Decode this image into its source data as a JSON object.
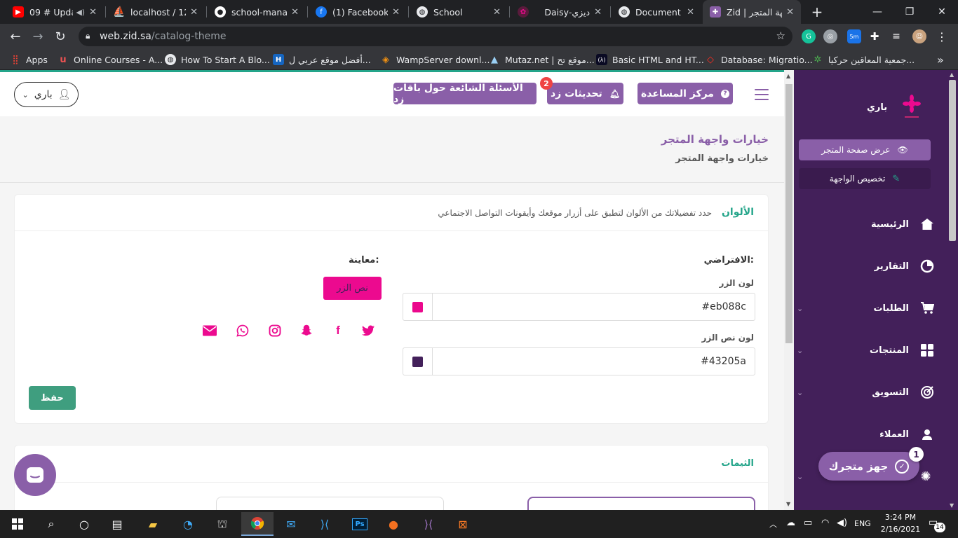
{
  "browser": {
    "tabs": [
      {
        "title": "09 # Upda",
        "icon": "youtube-icon",
        "color": "#ff0000"
      },
      {
        "title": "localhost / 127",
        "icon": "phpmyadmin-icon",
        "color": "#f29111"
      },
      {
        "title": "school-manag",
        "icon": "github-icon",
        "color": "#444444"
      },
      {
        "title": "(1) Facebook",
        "icon": "facebook-icon",
        "color": "#1877f2"
      },
      {
        "title": "School",
        "icon": "globe-icon",
        "color": "#5f6368"
      },
      {
        "title": "Daisy-ديزي",
        "icon": "daisy-icon",
        "color": "#ec0a8f"
      },
      {
        "title": "Document",
        "icon": "globe-icon",
        "color": "#5f6368"
      },
      {
        "title": "Zid | جهة المتجر",
        "icon": "zid-icon",
        "color": "#8a5fa8"
      }
    ],
    "new_tab": "+",
    "url_host": "web.zid.sa",
    "url_path": "/catalog-theme",
    "bookmarks": [
      {
        "label": "Apps",
        "icon": "apps-grid-icon"
      },
      {
        "label": "Online Courses - A...",
        "icon": "udemy-icon"
      },
      {
        "label": "How To Start A Blo...",
        "icon": "globe-icon"
      },
      {
        "label": "أفضل موقع عربي ل...",
        "icon": "h-icon"
      },
      {
        "label": "WampServer downl...",
        "icon": "wamp-icon"
      },
      {
        "label": "Mutaz.net | موقع تح...",
        "icon": "mutaz-icon"
      },
      {
        "label": "Basic HTML and HT...",
        "icon": "freecodecamp-icon"
      },
      {
        "label": "Database: Migratio...",
        "icon": "laravel-icon"
      },
      {
        "label": "جمعية المعاقين حركيا...",
        "icon": "association-icon"
      }
    ],
    "more_bookmarks": "»"
  },
  "topbar": {
    "help_center": "مركز المساعدة",
    "challenges": "تحديثات زد",
    "challenges_badge": "2",
    "faq": "الأسئلة الشائعة حول باقات زد",
    "user_name": "باري"
  },
  "heading": {
    "title": "خيارات واجهة المتجر",
    "breadcrumb": "خيارات واجهة المتجر"
  },
  "colors_card": {
    "title": "الألوان",
    "subtitle": "حدد تفضيلاتك من الألوان لتطبق على أزرار موقعك وأيقونات التواصل الاجتماعي",
    "default_label": "الافتراضي:",
    "preview_label": "معاينة:",
    "button_color_label": "لون الزر",
    "button_color_value": "#eb088c",
    "button_text_color_label": "لون نص الزر",
    "button_text_color_value": "#43205a",
    "preview_button": "نص الزر",
    "save_button": "حفظ",
    "accent": "#ec0a8f",
    "social_icons": [
      "twitter-icon",
      "facebook-icon",
      "snapchat-icon",
      "instagram-icon",
      "whatsapp-icon",
      "email-icon"
    ]
  },
  "themes_card": {
    "title": "الثيمات"
  },
  "sidebar": {
    "store_name": "باري",
    "view_store": "عرض صفحة المتجر",
    "customize": "تخصيص الواجهة",
    "items": [
      {
        "label": "الرئيسية",
        "icon": "home-icon",
        "has_children": false
      },
      {
        "label": "التقارير",
        "icon": "pie-chart-icon",
        "has_children": false
      },
      {
        "label": "الطلبات",
        "icon": "cart-icon",
        "has_children": true
      },
      {
        "label": "المنتجات",
        "icon": "grid-icon",
        "has_children": true
      },
      {
        "label": "التسويق",
        "icon": "target-icon",
        "has_children": true
      },
      {
        "label": "العملاء",
        "icon": "users-icon",
        "has_children": false
      }
    ]
  },
  "setup_widget": {
    "label": "جهز متجرك",
    "count": "1"
  },
  "taskbar": {
    "time": "3:24 PM",
    "date": "2/16/2021",
    "lang": "ENG",
    "notifications": "14"
  }
}
